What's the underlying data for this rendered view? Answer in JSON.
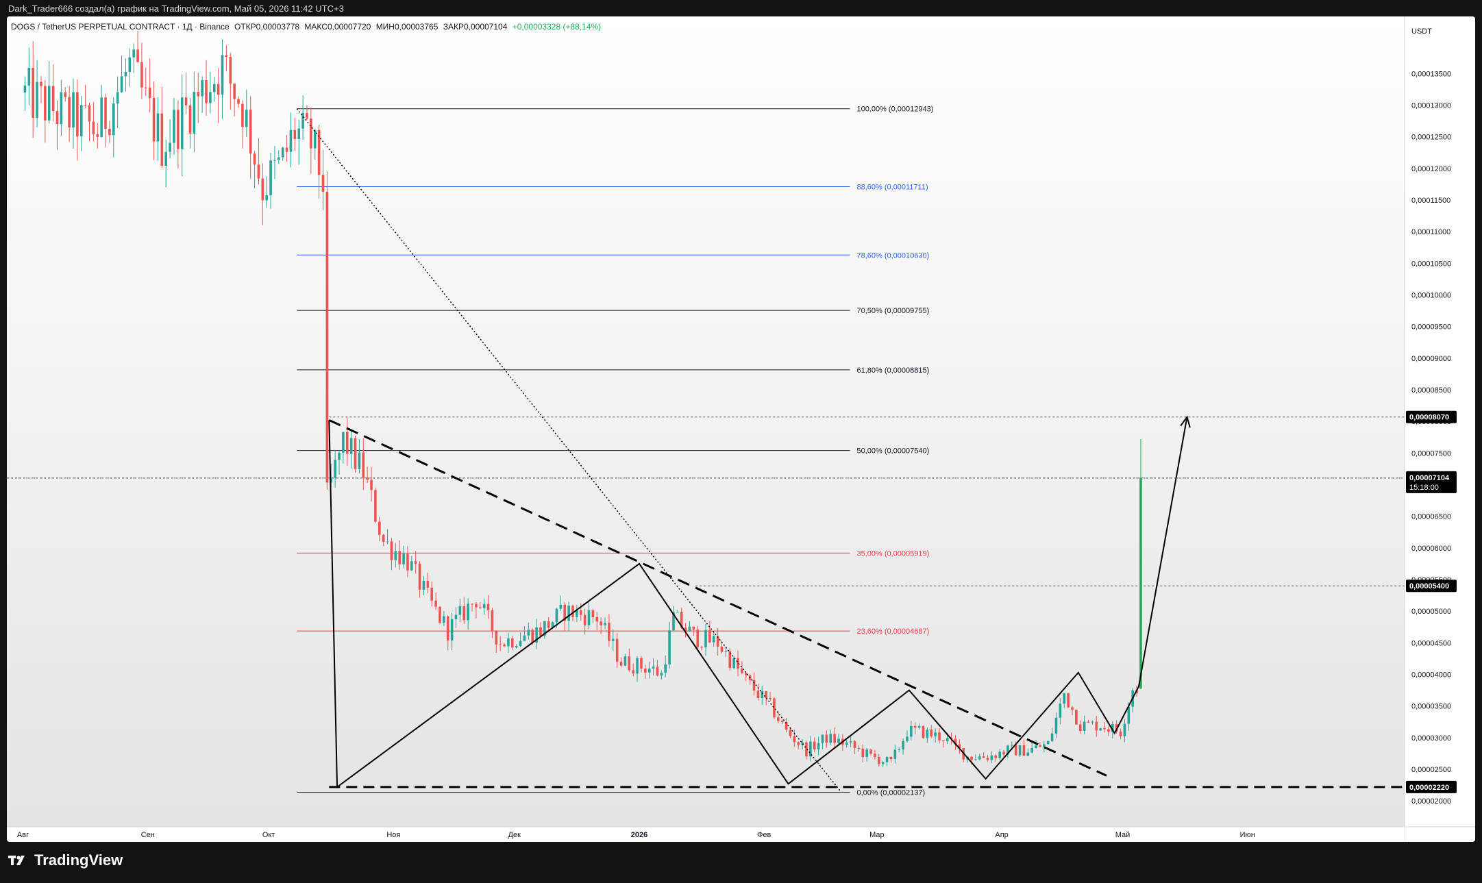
{
  "header": {
    "publish_line": "Dark_Trader666 создал(а) график на TradingView.com, Май 05, 2026 11:42 UTC+3"
  },
  "legend": {
    "symbol": "DOGS / TetherUS PERPETUAL CONTRACT · 1Д · Binance",
    "open": "ОТКР0,00003778",
    "high": "МАКС0,00007720",
    "low": "МИН0,00003765",
    "close": "ЗАКР0,00007104",
    "change": "+0,00003328 (+88,14%)"
  },
  "price_axis": {
    "currency": "USDT",
    "current_price_label": "0,00007104",
    "countdown": "15:18:00",
    "ticks": [
      "0,00013500",
      "0,00013000",
      "0,00012500",
      "0,00012000",
      "0,00011500",
      "0,00011000",
      "0,00010500",
      "0,00010000",
      "0,00009500",
      "0,00009000",
      "0,00008500",
      "0,00008000",
      "0,00007500",
      "0,00007000",
      "0,00006500",
      "0,00006000",
      "0,00005500",
      "0,00005000",
      "0,00004500",
      "0,00004000",
      "0,00003500",
      "0,00003000",
      "0,00002500",
      "0,00002000"
    ],
    "markers": [
      {
        "label": "0,00008070",
        "value": 8.07e-05
      },
      {
        "label": "0,00005400",
        "value": 5.4e-05
      },
      {
        "label": "0,00002220",
        "value": 2.22e-05
      }
    ]
  },
  "brand": {
    "name": "TradingView"
  },
  "colors": {
    "up": "#26a69a",
    "up_bright": "#22ab54",
    "down": "#ef5350",
    "fib_blue": "#2962ff",
    "fib_red": "#f23645",
    "fib_black": "#131722"
  },
  "chart_data": {
    "type": "candlestick",
    "timeframe": "1D",
    "x_axis": {
      "labels": [
        "Авг",
        "Сен",
        "Окт",
        "Ноя",
        "Дек",
        "2026",
        "Фев",
        "Мар",
        "Апр",
        "Май",
        "Июн"
      ],
      "months": [
        [
          2025,
          8
        ],
        [
          2025,
          9
        ],
        [
          2025,
          10
        ],
        [
          2025,
          11
        ],
        [
          2025,
          12
        ],
        [
          2026,
          1
        ],
        [
          2026,
          2
        ],
        [
          2026,
          3
        ],
        [
          2026,
          4
        ],
        [
          2026,
          5
        ],
        [
          2026,
          6
        ]
      ],
      "range_start": "2025-07-28",
      "range_end": "2026-07-10"
    },
    "y_axis": {
      "min": 1.71e-05,
      "max": 0.0001425,
      "scale": "linear"
    },
    "last_candle": {
      "date": "2026-05-05",
      "open": 3.778e-05,
      "high": 7.72e-05,
      "low": 3.765e-05,
      "close": 7.104e-05
    },
    "price_path": [
      [
        "2025-08-01",
        0.000132
      ],
      [
        "2025-08-10",
        0.000129
      ],
      [
        "2025-08-20",
        0.000126
      ],
      [
        "2025-08-28",
        0.000136
      ],
      [
        "2025-09-05",
        0.000124
      ],
      [
        "2025-09-12",
        0.00013
      ],
      [
        "2025-09-20",
        0.000136
      ],
      [
        "2025-09-25",
        0.00013
      ],
      [
        "2025-09-30",
        0.000117
      ],
      [
        "2025-10-05",
        0.000121
      ],
      [
        "2025-10-08",
        0.000126
      ],
      [
        "2025-10-12",
        0.000124
      ],
      [
        "2025-10-15",
        0.000118
      ],
      [
        "2025-10-16",
        6.8e-05
      ],
      [
        "2025-10-20",
        7.7e-05
      ],
      [
        "2025-10-25",
        7.2e-05
      ],
      [
        "2025-10-30",
        6.1e-05
      ],
      [
        "2025-11-05",
        5.8e-05
      ],
      [
        "2025-11-10",
        5.2e-05
      ],
      [
        "2025-11-15",
        4.7e-05
      ],
      [
        "2025-11-22",
        5.2e-05
      ],
      [
        "2025-11-28",
        4.5e-05
      ],
      [
        "2025-12-03",
        4.6e-05
      ],
      [
        "2025-12-08",
        4.7e-05
      ],
      [
        "2025-12-14",
        5e-05
      ],
      [
        "2025-12-22",
        4.9e-05
      ],
      [
        "2025-12-28",
        4.2e-05
      ],
      [
        "2026-01-04",
        4.1e-05
      ],
      [
        "2026-01-07",
        4e-05
      ],
      [
        "2026-01-10",
        4.9e-05
      ],
      [
        "2026-01-15",
        4.6e-05
      ],
      [
        "2026-01-21",
        4.5e-05
      ],
      [
        "2026-01-28",
        3.9e-05
      ],
      [
        "2026-02-03",
        3.5e-05
      ],
      [
        "2026-02-07",
        3.1e-05
      ],
      [
        "2026-02-12",
        2.8e-05
      ],
      [
        "2026-02-17",
        3e-05
      ],
      [
        "2026-02-22",
        2.9e-05
      ],
      [
        "2026-02-28",
        2.7e-05
      ],
      [
        "2026-03-05",
        2.6e-05
      ],
      [
        "2026-03-09",
        3.1e-05
      ],
      [
        "2026-03-12",
        3.1e-05
      ],
      [
        "2026-03-18",
        3e-05
      ],
      [
        "2026-03-24",
        2.7e-05
      ],
      [
        "2026-03-29",
        2.7e-05
      ],
      [
        "2026-04-03",
        2.8e-05
      ],
      [
        "2026-04-08",
        2.8e-05
      ],
      [
        "2026-04-13",
        2.9e-05
      ],
      [
        "2026-04-17",
        3.7e-05
      ],
      [
        "2026-04-21",
        3.2e-05
      ],
      [
        "2026-04-26",
        3.2e-05
      ],
      [
        "2026-05-01",
        3.1e-05
      ],
      [
        "2026-05-04",
        3.778e-05
      ]
    ],
    "fibonacci": {
      "anchor_start_date": "2025-10-08",
      "label_date": "2026-02-24",
      "levels": [
        {
          "label": "100,00% (0,00012943)",
          "value": 0.00012943,
          "color": "#131722"
        },
        {
          "label": "88,60% (0,00011711)",
          "value": 0.00011711,
          "color": "#2962ff"
        },
        {
          "label": "78,60% (0,00010630)",
          "value": 0.0001063,
          "color": "#2962ff"
        },
        {
          "label": "70,50% (0,00009755)",
          "value": 9.755e-05,
          "color": "#131722"
        },
        {
          "label": "61,80% (0,00008815)",
          "value": 8.815e-05,
          "color": "#131722"
        },
        {
          "label": "50,00% (0,00007540)",
          "value": 7.54e-05,
          "color": "#131722"
        },
        {
          "label": "35,00% (0,00005919)",
          "value": 5.919e-05,
          "color": "#f23645"
        },
        {
          "label": "23,60% (0,00004687)",
          "value": 4.687e-05,
          "color": "#f23645"
        },
        {
          "label": "0,00% (0,00002137)",
          "value": 2.137e-05,
          "color": "#131722"
        }
      ]
    },
    "horizontal_levels": [
      {
        "value": 8.07e-05,
        "style": "dotted"
      },
      {
        "value": 7.104e-05,
        "style": "dotted"
      },
      {
        "value": 5.4e-05,
        "style": "dotted"
      },
      {
        "value": 2.22e-05,
        "style": "dashed-bold"
      }
    ],
    "zigzag": [
      [
        "2025-10-16",
        8.02e-05
      ],
      [
        "2025-10-18",
        2.22e-05
      ],
      [
        "2026-01-01",
        5.75e-05
      ],
      [
        "2026-02-07",
        2.27e-05
      ],
      [
        "2026-03-09",
        3.75e-05
      ],
      [
        "2026-03-28",
        2.35e-05
      ],
      [
        "2026-04-20",
        4.03e-05
      ],
      [
        "2026-04-29",
        3.07e-05
      ],
      [
        "2026-05-05",
        3.81e-05
      ],
      [
        "2026-05-17",
        8.07e-05
      ]
    ],
    "trendlines": [
      {
        "from": [
          "2025-10-16",
          8.02e-05
        ],
        "to": [
          "2026-04-27",
          2.4e-05
        ],
        "style": "dashed"
      },
      {
        "from": [
          "2025-10-08",
          0.00012943
        ],
        "to": [
          "2026-02-20",
          2.15e-05
        ],
        "style": "dotted"
      }
    ]
  }
}
